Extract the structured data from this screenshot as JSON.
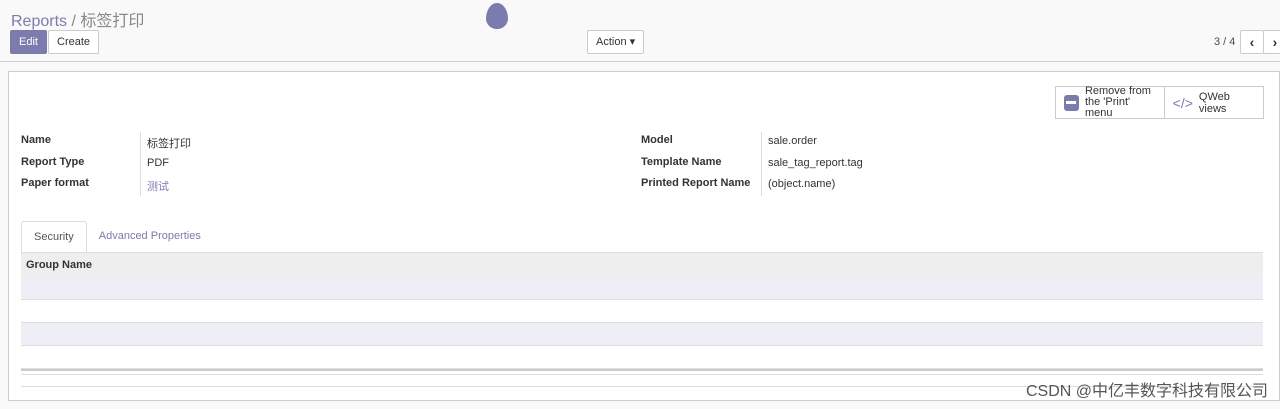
{
  "breadcrumb": {
    "parent": "Reports",
    "separator": "/",
    "current": "标签打印"
  },
  "toolbar": {
    "edit": "Edit",
    "create": "Create",
    "action": "Action ▾",
    "pager": "3 / 4",
    "prev": "‹",
    "next": "›"
  },
  "buttons": {
    "remove_print_1": "Remove from",
    "remove_print_2": "the 'Print' menu",
    "qweb": "QWeb views"
  },
  "fields": {
    "name_label": "Name",
    "name": "标签打印",
    "type_label": "Report Type",
    "type": "PDF",
    "paper_label": "Paper format",
    "paper": "测试",
    "model_label": "Model",
    "model": "sale.order",
    "template_label": "Template Name",
    "template": "sale_tag_report.tag",
    "printed_label": "Printed Report Name",
    "printed": "(object.name)"
  },
  "tabs": [
    "Security",
    "Advanced Properties"
  ],
  "table": {
    "header": "Group Name"
  },
  "watermark": "CSDN @中亿丰数字科技有限公司",
  "colors": {
    "accent": "#7c7bad"
  }
}
